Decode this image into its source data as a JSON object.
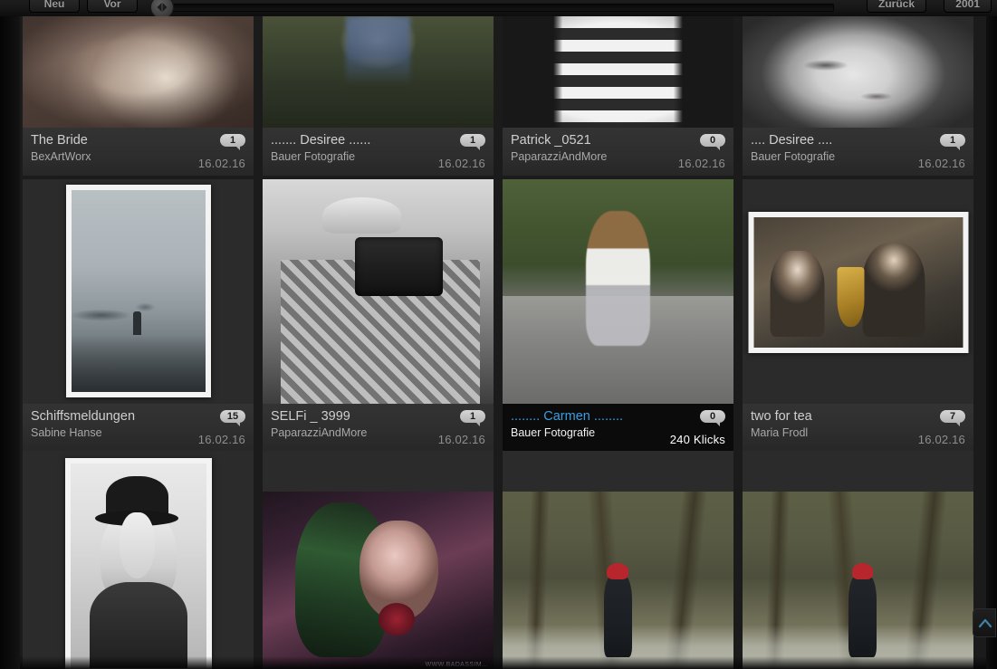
{
  "toolbar": {
    "neu_label": "Neu",
    "vor_label": "Vor",
    "zurueck_label": "Zurück",
    "year_label": "2001"
  },
  "gallery": {
    "cards": [
      {
        "title": "The Bride",
        "author": "BexArtWorx",
        "badge": "1",
        "meta": "16.02.16",
        "active": false,
        "photo": "bride"
      },
      {
        "title": "....... Desiree ......",
        "author": "Bauer Fotografie",
        "badge": "1",
        "meta": "16.02.16",
        "active": false,
        "photo": "desiree-shorts"
      },
      {
        "title": "Patrick _0521",
        "author": "PaparazziAndMore",
        "badge": "0",
        "meta": "16.02.16",
        "active": false,
        "photo": "striped-sweater"
      },
      {
        "title": ".... Desiree ....",
        "author": "Bauer Fotografie",
        "badge": "1",
        "meta": "16.02.16",
        "active": false,
        "photo": "desiree-face"
      },
      {
        "title": "Schiffsmeldungen",
        "author": "Sabine Hanse",
        "badge": "15",
        "meta": "16.02.16",
        "active": false,
        "photo": "harbour-mist"
      },
      {
        "title": "SELFi _ 3999",
        "author": "PaparazziAndMore",
        "badge": "1",
        "meta": "16.02.16",
        "active": false,
        "photo": "photographer-bw"
      },
      {
        "title": "........ Carmen ........",
        "author": "Bauer Fotografie",
        "badge": "0",
        "meta": "240 Klicks",
        "active": true,
        "photo": "carmen-road"
      },
      {
        "title": "two for tea",
        "author": "Maria Frodl",
        "badge": "7",
        "meta": "16.02.16",
        "active": false,
        "photo": "band-sax"
      }
    ],
    "bottom_row_photos": [
      "singer-hat-bw",
      "gothic-green-hair",
      "winter-forest-red-hat-a",
      "winter-forest-red-hat-b"
    ],
    "watermark": "WWW.BADASSIM..."
  },
  "scroll_top": {
    "icon": "chevron-up-icon"
  },
  "colors": {
    "page_bg": "#1b1b1b",
    "caption_bg": "#2e2e2e",
    "caption_active_bg": "#0b0b0b",
    "title": "#cfcfcf",
    "title_active": "#3a9fe0",
    "author": "#a8a8a8",
    "meta": "#8e8e8e",
    "badge_bg": "#c4c4c4",
    "badge_text": "#1c1c1c",
    "accent": "#3a9fe0"
  }
}
